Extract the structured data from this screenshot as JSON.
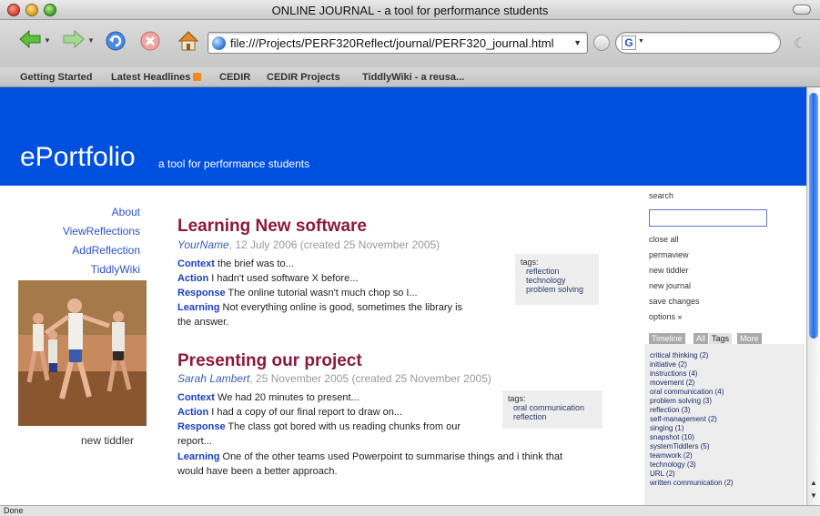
{
  "window": {
    "title": "ONLINE JOURNAL - a tool for performance students"
  },
  "address": {
    "url": "file:///Projects/PERF320Reflect/journal/PERF320_journal.html"
  },
  "search_engine": {
    "glyph": "G"
  },
  "bookmarks": [
    "Getting Started",
    "Latest Headlines",
    "CEDIR",
    "CEDIR Projects",
    "TiddlyWiki - a reusa..."
  ],
  "site": {
    "title": "ePortfolio",
    "subtitle": "a tool for performance students"
  },
  "main_menu": [
    "About",
    "ViewReflections",
    "AddReflection",
    "TiddlyWiki"
  ],
  "left_new_tiddler": "new tiddler",
  "tiddlers": [
    {
      "title": "Learning New software",
      "author": "YourName",
      "date": ", 12 July 2006 (created 25 November 2005)",
      "lines": [
        {
          "label": "Context",
          "text": " the brief was to..."
        },
        {
          "label": "Action",
          "text": " I hadn't used software X before..."
        },
        {
          "label": "Response",
          "text": " The online tutorial wasn't much chop so I..."
        },
        {
          "label": "Learning",
          "text": " Not everything online is good, sometimes the library is"
        },
        {
          "label": "",
          "text": "the answer."
        }
      ],
      "tags_label": "tags:",
      "tags": [
        "reflection",
        "technology",
        "problem solving"
      ]
    },
    {
      "title": "Presenting our project",
      "author": "Sarah Lambert",
      "date": ", 25 November 2005 (created 25 November 2005)",
      "lines": [
        {
          "label": "Context",
          "text": " We had 20 minutes to present..."
        },
        {
          "label": "Action",
          "text": " I had a copy of our final report to draw on..."
        },
        {
          "label": "Response",
          "text": " The class got bored with us reading chunks from our"
        },
        {
          "label": "",
          "text": "report..."
        },
        {
          "label": "Learning",
          "text": " One of the other teams used Powerpoint to summarise things and i think that"
        },
        {
          "label": "",
          "text": "would have been a better approach."
        }
      ],
      "tags_label": "tags:",
      "tags": [
        "oral communication",
        "reflection"
      ]
    }
  ],
  "sidebar": {
    "search_label": "search",
    "options": [
      "close all",
      "permaview",
      "new tiddler",
      "new journal",
      "save changes",
      "options »"
    ],
    "tabs": [
      "Timeline",
      "All",
      "Tags",
      "More"
    ],
    "tag_list": [
      "critical thinking (2)",
      "initiative (2)",
      "instructions (4)",
      "movement (2)",
      "oral communication (4)",
      "problem solving (3)",
      "reflection (3)",
      "self-management (2)",
      "singing (1)",
      "snapshot (10)",
      "systemTiddlers (5)",
      "teamwork (2)",
      "technology (3)",
      "URL (2)",
      "written communication (2)"
    ]
  },
  "status": "Done"
}
